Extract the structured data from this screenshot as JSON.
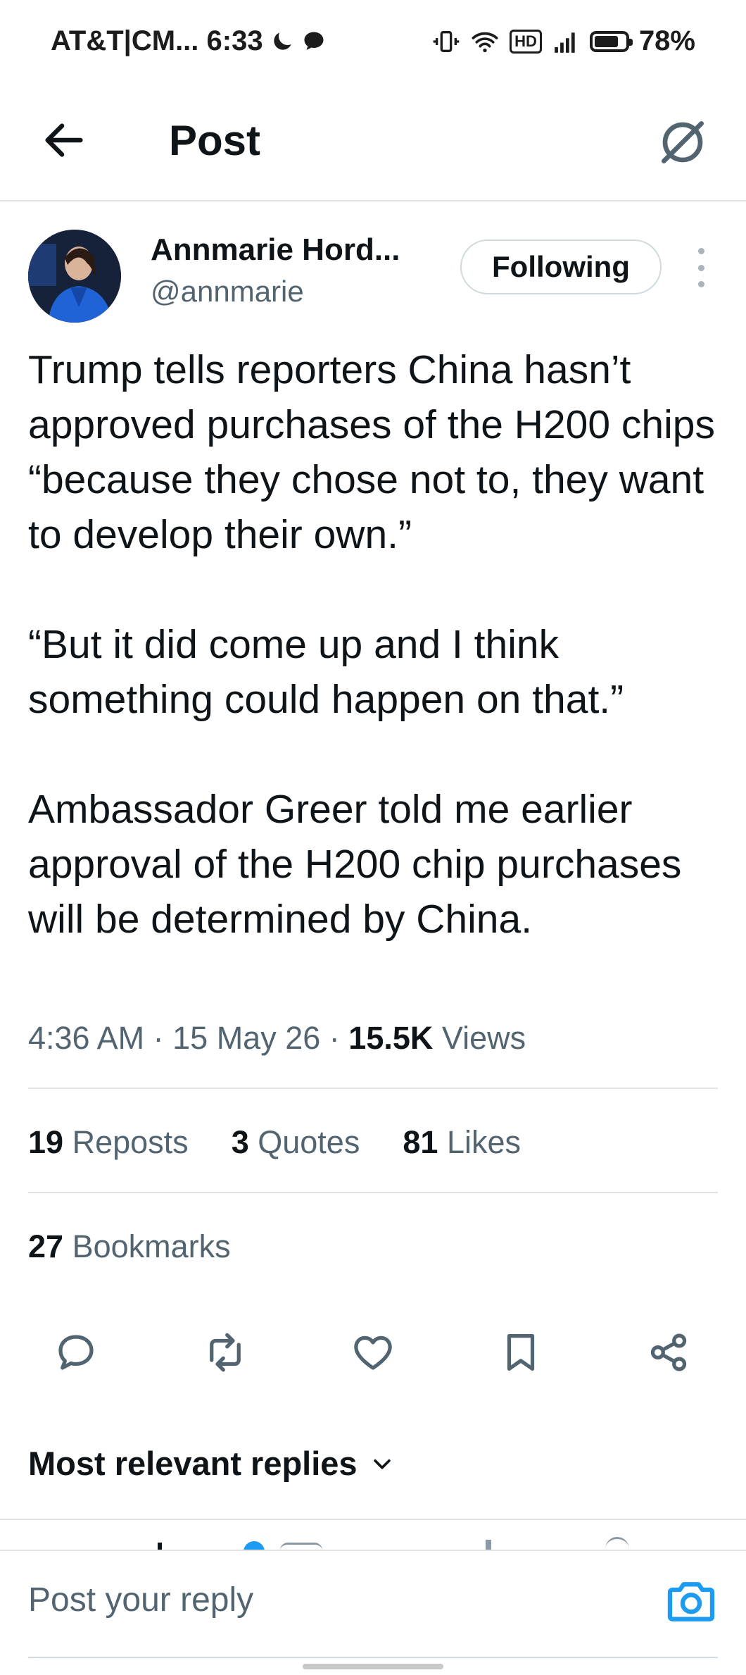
{
  "status_bar": {
    "carrier_time": "AT&T|CM... 6:33",
    "signal_label": "HD",
    "battery_percent": "78%",
    "battery_level": 0.78
  },
  "header": {
    "title": "Post",
    "back_icon": "arrow-left-icon",
    "grok_icon": "grok-icon"
  },
  "post": {
    "author_name": "Annmarie Hord...",
    "author_handle": "@annmarie",
    "follow_label": "Following",
    "paragraphs": [
      "Trump tells reporters China hasn’t approved purchases of the H200 chips “because they chose not to, they want to develop their own.”",
      "“But it did come up and I think something could happen on that.”",
      "Ambassador Greer told me earlier approval of the H200 chip purchases will be determined by China."
    ],
    "time": "4:36 AM",
    "date": "15 May 26",
    "views_count": "15.5K",
    "views_label": "Views",
    "separator": "·"
  },
  "stats": {
    "reposts_count": "19",
    "reposts_label": "Reposts",
    "quotes_count": "3",
    "quotes_label": "Quotes",
    "likes_count": "81",
    "likes_label": "Likes",
    "bookmarks_count": "27",
    "bookmarks_label": "Bookmarks"
  },
  "actions": [
    "reply-icon",
    "repost-icon",
    "like-icon",
    "bookmark-icon",
    "share-icon"
  ],
  "replies": {
    "sort_label": "Most relevant replies"
  },
  "composer": {
    "placeholder": "Post your reply",
    "camera_icon": "camera-icon"
  },
  "colors": {
    "text_primary": "#0f1419",
    "text_secondary": "#536471",
    "divider": "#dfe3e6",
    "accent_blue": "#1d9bf0"
  }
}
